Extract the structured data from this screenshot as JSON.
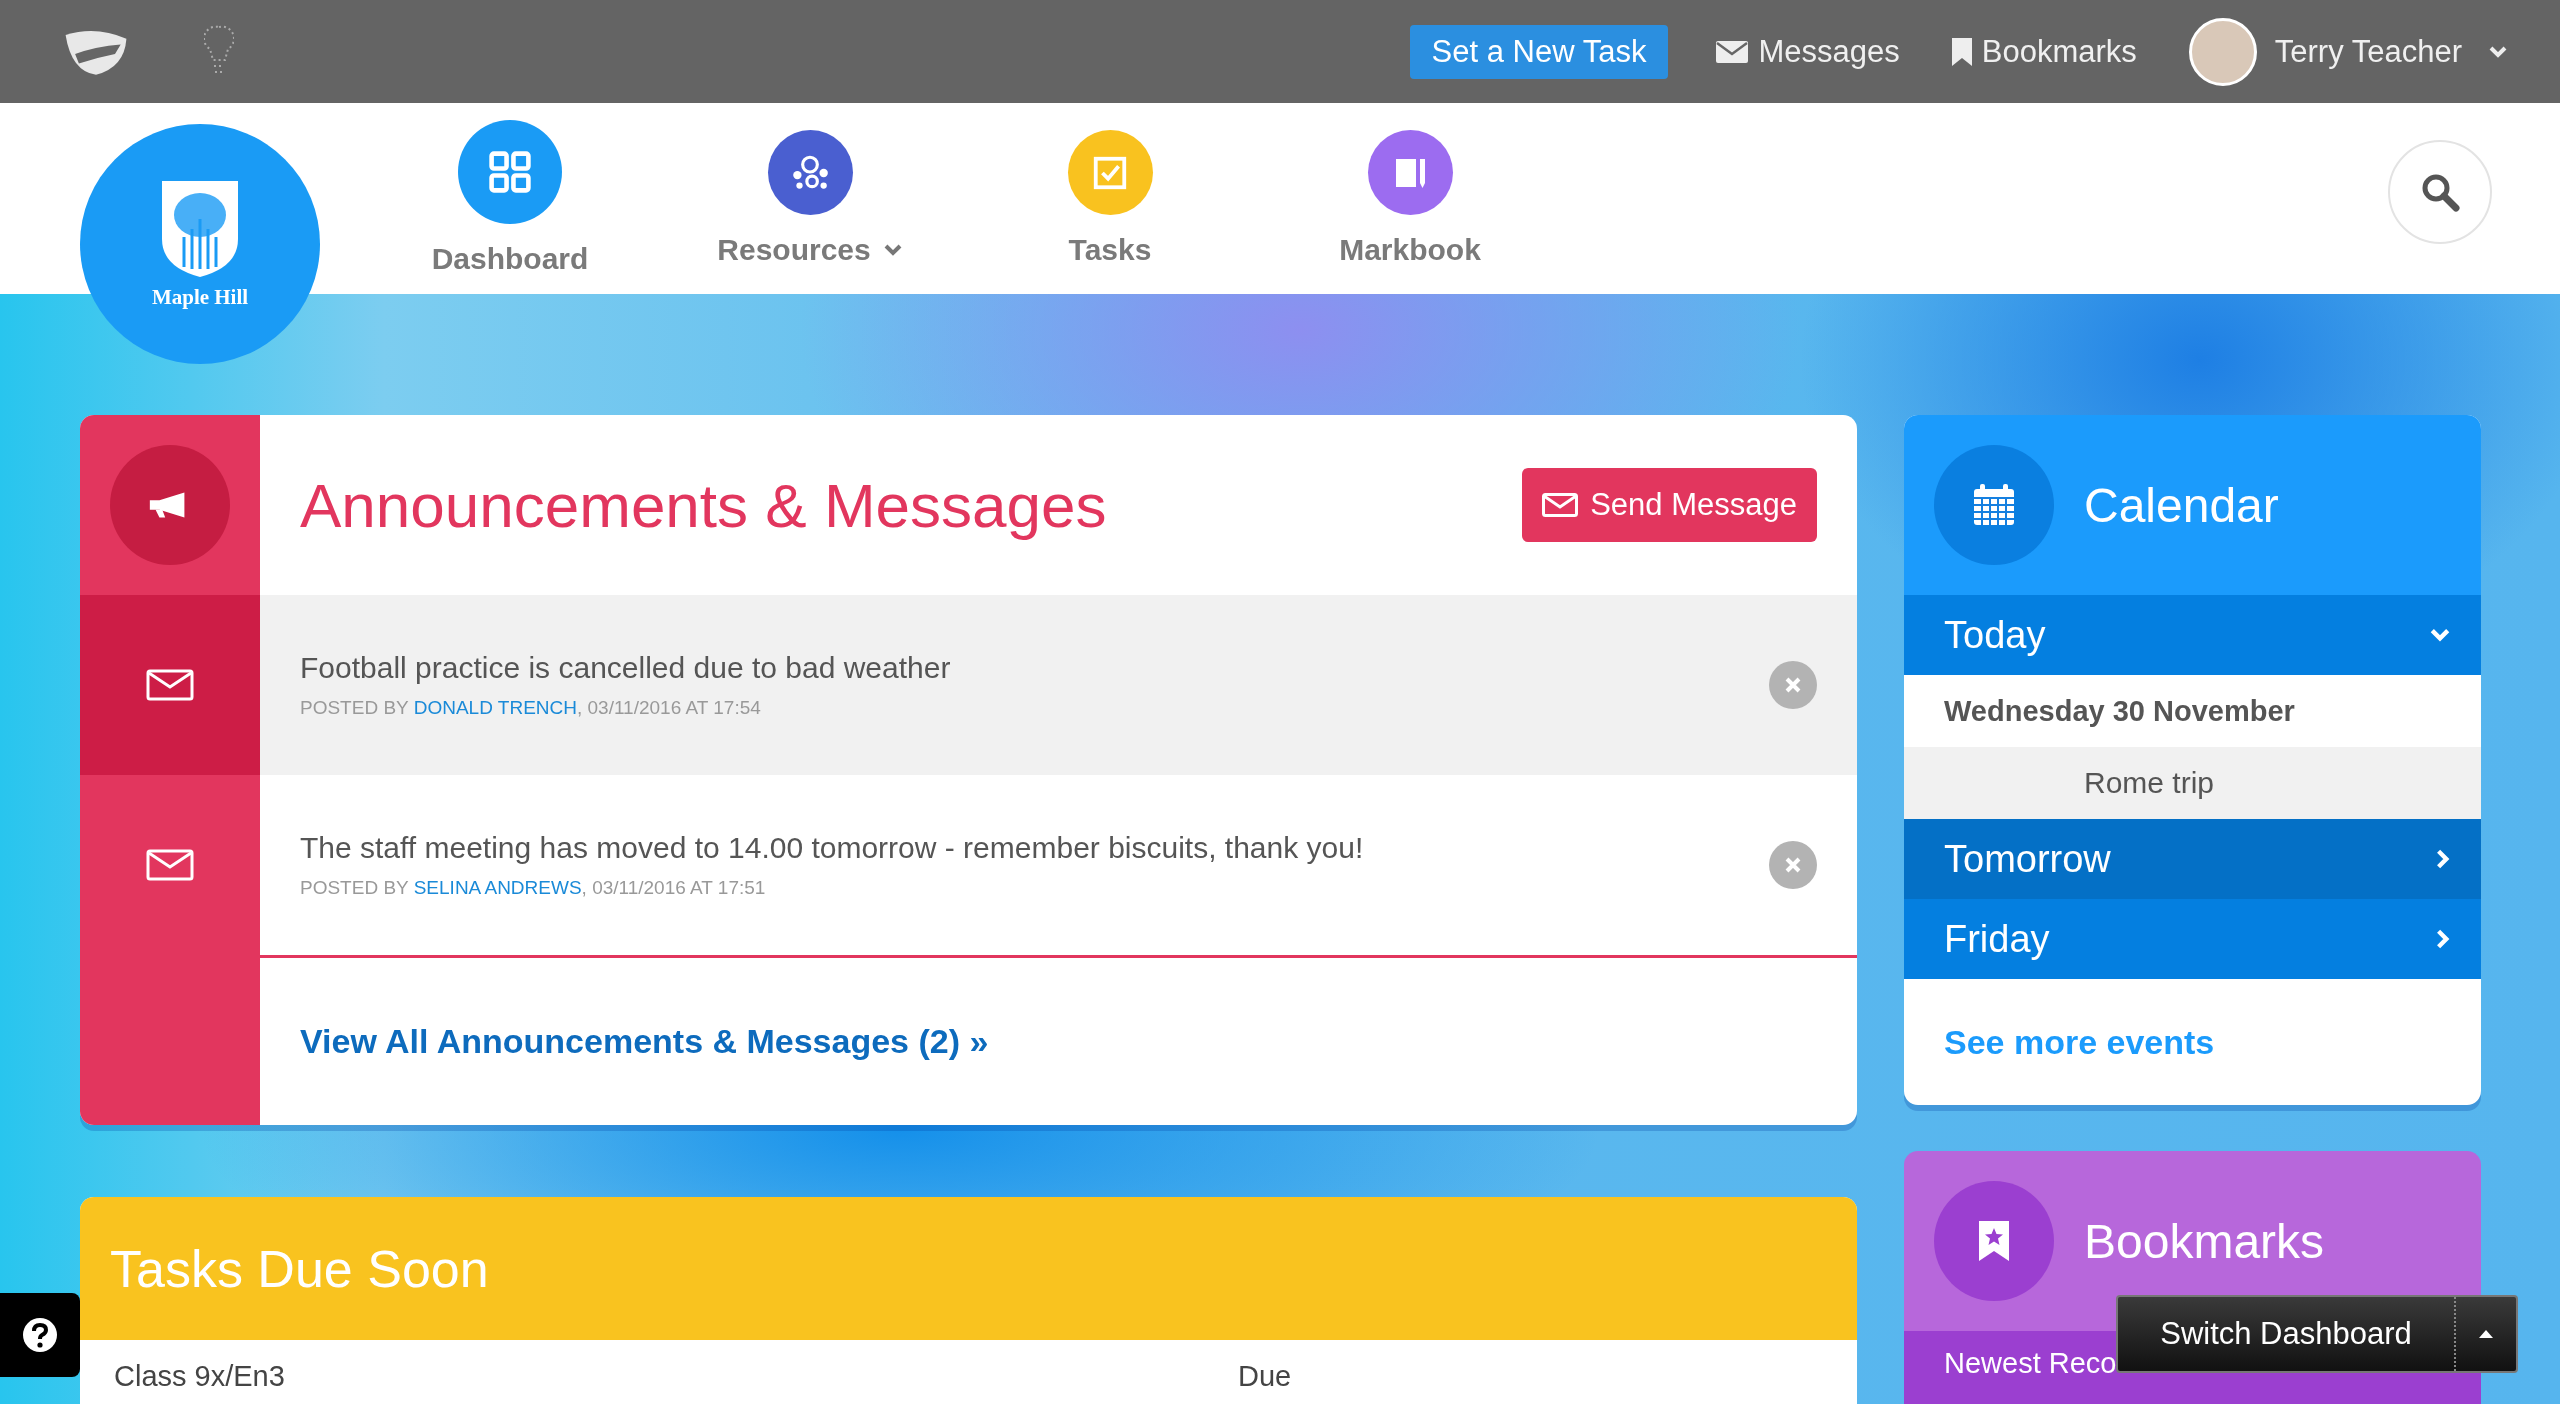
{
  "top_bar": {
    "task_button": "Set a New Task",
    "links": [
      {
        "label": "Messages",
        "kind": "envelope"
      },
      {
        "label": "Bookmarks",
        "kind": "bookmark"
      }
    ],
    "user": {
      "name": "Terry Teacher"
    }
  },
  "school": {
    "name": "Maple Hill"
  },
  "nav": {
    "items": [
      {
        "label": "Dashboard",
        "kind": "grid",
        "color": "#1a9bf5",
        "dropdown": false
      },
      {
        "label": "Resources",
        "kind": "circles",
        "color": "#4a5fd0",
        "dropdown": true
      },
      {
        "label": "Tasks",
        "kind": "checkbox",
        "color": "#f9c21f",
        "dropdown": false
      },
      {
        "label": "Markbook",
        "kind": "book",
        "color": "#9c6cf0",
        "dropdown": false
      }
    ]
  },
  "announcements": {
    "title": "Announcements & Messages",
    "send_button": "Send Message",
    "messages": [
      {
        "text": "Football practice is cancelled due to bad weather",
        "prefix": "POSTED BY",
        "author": "DONALD TRENCH",
        "suffix": ", 03/11/2016 AT 17:54",
        "selected": true
      },
      {
        "text": "The staff meeting has moved to 14.00 tomorrow - remember biscuits, thank you!",
        "prefix": "POSTED BY",
        "author": "SELINA ANDREWS",
        "suffix": ", 03/11/2016 AT 17:51",
        "selected": false
      }
    ],
    "view_all": "View All Announcements & Messages (2) »"
  },
  "calendar": {
    "title": "Calendar",
    "groups": [
      {
        "label": "Today",
        "expanded": true,
        "selected": false,
        "date": "Wednesday 30 November",
        "events": [
          "Rome trip"
        ]
      },
      {
        "label": "Tomorrow",
        "expanded": false,
        "selected": true
      },
      {
        "label": "Friday",
        "expanded": false,
        "selected": false
      }
    ],
    "see_more": "See more events"
  },
  "tasks": {
    "title": "Tasks Due Soon",
    "columns": [
      "Class 9x/En3",
      "Due"
    ]
  },
  "bookmarks": {
    "title": "Bookmarks",
    "subtitle": "Newest Reco"
  },
  "switch_dashboard": "Switch Dashboard"
}
